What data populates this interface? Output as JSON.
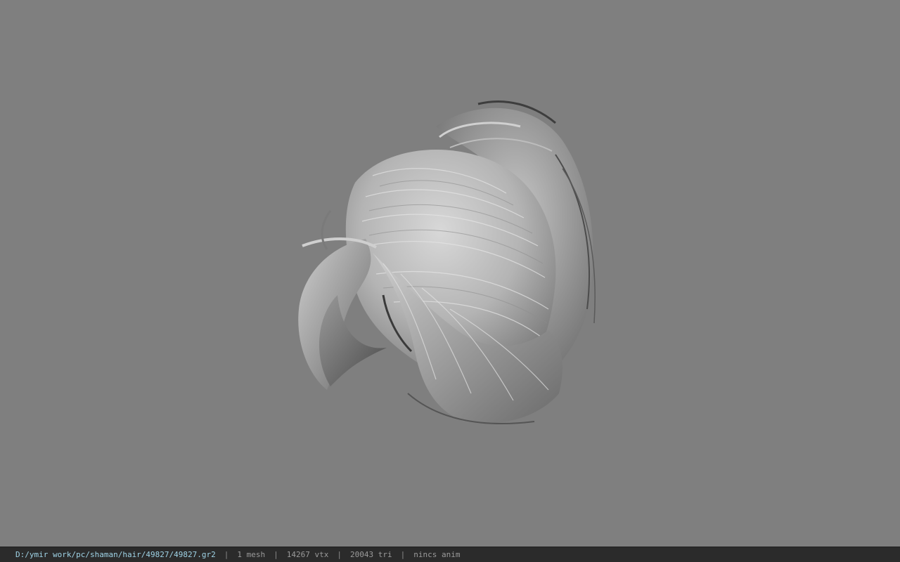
{
  "viewport": {
    "background": "#7f7f7f",
    "model_icon": "hair-mesh-render"
  },
  "statusbar": {
    "file_path": "D:/ymir work/pc/shaman/hair/49827/49827.gr2",
    "separator": "|",
    "mesh_count": "1 mesh",
    "vertex_count": "14267 vtx",
    "triangle_count": "20043 tri",
    "anim_status": "nincs anim",
    "path_color": "#9fd3e6",
    "text_color": "#9a9a9a",
    "background": "#2b2b2b"
  }
}
